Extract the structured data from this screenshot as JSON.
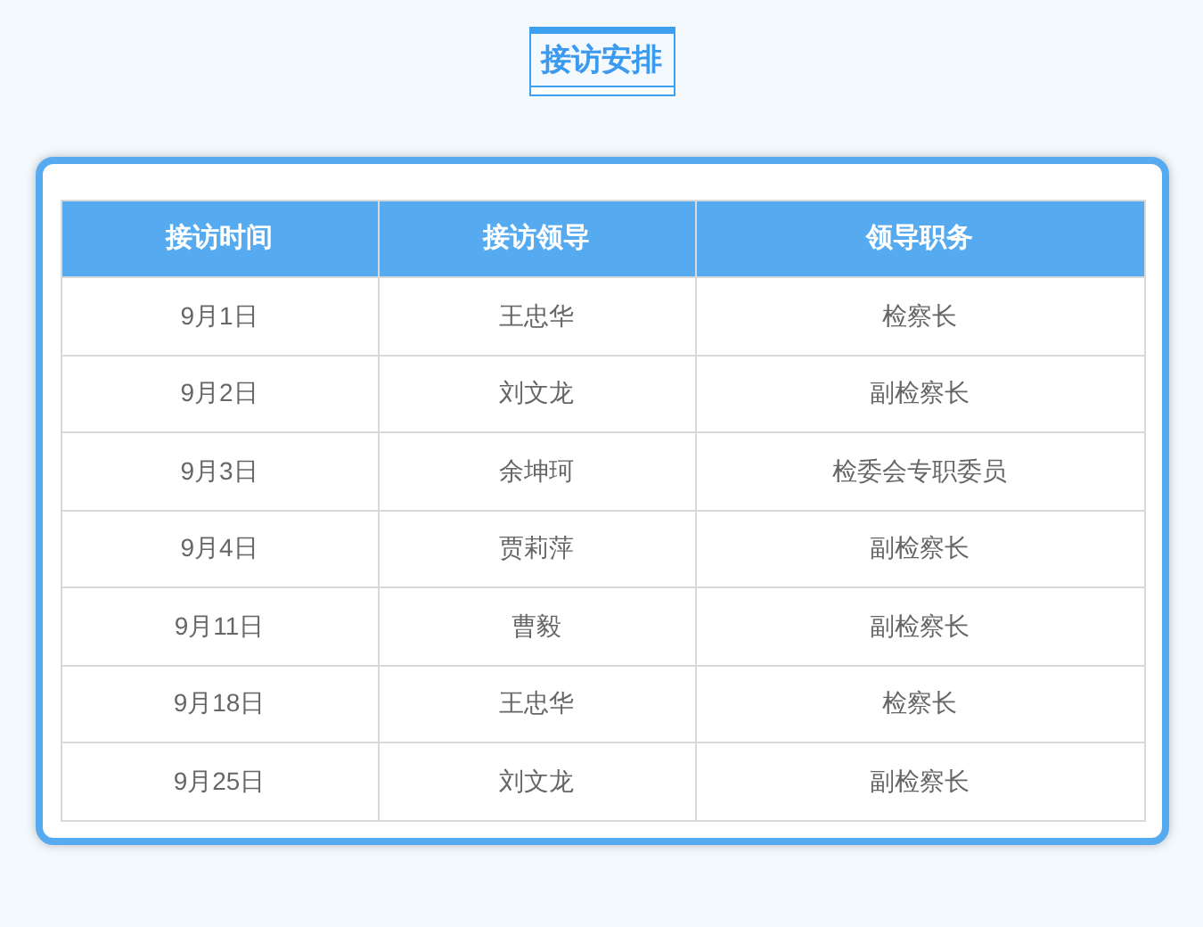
{
  "title": "接访安排",
  "table": {
    "columns": [
      "接访时间",
      "接访领导",
      "领导职务"
    ],
    "rows": [
      [
        "9月1日",
        "王忠华",
        "检察长"
      ],
      [
        "9月2日",
        "刘文龙",
        "副检察长"
      ],
      [
        "9月3日",
        "余坤珂",
        "检委会专职委员"
      ],
      [
        "9月4日",
        "贾莉萍",
        "副检察长"
      ],
      [
        "9月11日",
        "曹毅",
        "副检察长"
      ],
      [
        "9月18日",
        "王忠华",
        "检察长"
      ],
      [
        "9月25日",
        "刘文龙",
        "副检察长"
      ]
    ]
  }
}
